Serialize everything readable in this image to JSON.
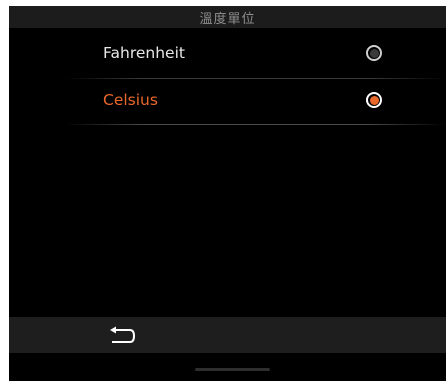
{
  "header": {
    "title": "溫度單位"
  },
  "options": [
    {
      "label": "Fahrenheit",
      "selected": false
    },
    {
      "label": "Celsius",
      "selected": true
    }
  ],
  "colors": {
    "accent": "#e8692a",
    "background": "#000000",
    "bar": "#1e1e1e",
    "text": "#e8e8e8"
  },
  "icons": {
    "back": "back-arrow-icon",
    "radio_off": "radio-unselected-icon",
    "radio_on": "radio-selected-icon"
  }
}
